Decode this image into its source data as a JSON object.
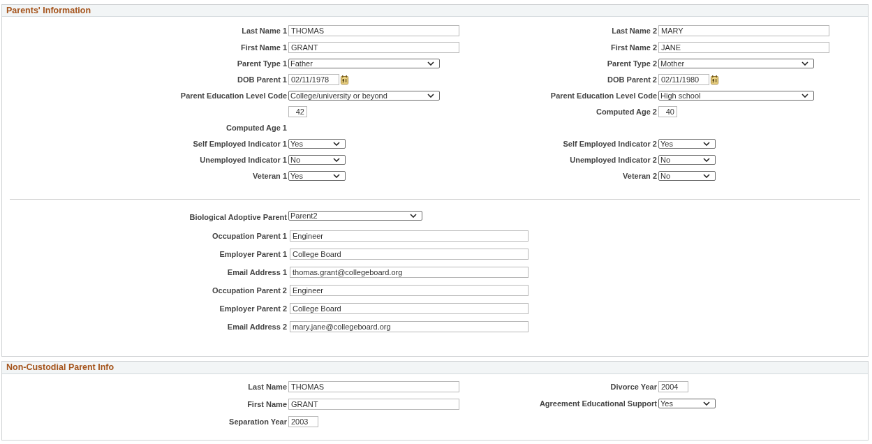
{
  "parents_information": {
    "title": "Parents' Information",
    "columns": [
      {
        "fields": [
          {
            "label": "Last Name 1",
            "kind": "text",
            "value": "THOMAS"
          },
          {
            "label": "First Name 1",
            "kind": "text",
            "value": "GRANT"
          },
          {
            "label": "Parent Type 1",
            "kind": "select",
            "value": "Father"
          },
          {
            "label": "DOB Parent 1",
            "kind": "date",
            "value": "02/11/1978"
          },
          {
            "label": "Parent Education Level Code",
            "kind": "select",
            "value": "College/university or beyond"
          },
          {
            "label": "Computed Age 1",
            "kind": "number",
            "value": "42"
          }
        ],
        "indicators": [
          {
            "label": "Self Employed Indicator 1",
            "kind": "yesno",
            "value": "Yes"
          },
          {
            "label": "Unemployed Indicator 1",
            "kind": "yesno",
            "value": "No"
          },
          {
            "label": "Veteran 1",
            "kind": "yesno",
            "value": "Yes"
          }
        ]
      },
      {
        "fields": [
          {
            "label": "Last Name 2",
            "kind": "text",
            "value": "MARY"
          },
          {
            "label": "First Name 2",
            "kind": "text",
            "value": "JANE"
          },
          {
            "label": "Parent Type 2",
            "kind": "select",
            "value": "Mother"
          },
          {
            "label": "DOB Parent 2",
            "kind": "date",
            "value": "02/11/1980"
          },
          {
            "label": "Parent Education Level Code",
            "kind": "select",
            "value": "High school"
          },
          {
            "label": "Computed Age 2",
            "kind": "number",
            "value": "40"
          }
        ],
        "indicators": [
          {
            "label": "Self Employed Indicator 2",
            "kind": "yesno",
            "value": "Yes"
          },
          {
            "label": "Unemployed Indicator 2",
            "kind": "yesno",
            "value": "No"
          },
          {
            "label": "Veteran 2",
            "kind": "yesno",
            "value": "No"
          }
        ]
      }
    ],
    "details": [
      {
        "label": "Biological Adoptive Parent",
        "kind": "select",
        "value": "Parent2"
      },
      {
        "label": "Occupation Parent 1",
        "kind": "text",
        "value": "Engineer"
      },
      {
        "label": "Employer Parent 1",
        "kind": "text",
        "value": "College Board"
      },
      {
        "label": "Email Address 1",
        "kind": "text",
        "value": "thomas.grant@collegeboard.org"
      },
      {
        "label": "Occupation Parent 2",
        "kind": "text",
        "value": "Engineer"
      },
      {
        "label": "Employer Parent 2",
        "kind": "text",
        "value": "College Board"
      },
      {
        "label": "Email Address 2",
        "kind": "text",
        "value": "mary.jane@collegeboard.org"
      }
    ]
  },
  "non_custodial_parent_info": {
    "title": "Non-Custodial Parent Info",
    "columns": [
      {
        "fields": [
          {
            "label": "Last Name",
            "kind": "text",
            "value": "THOMAS"
          },
          {
            "label": "First Name",
            "kind": "text",
            "value": "GRANT"
          },
          {
            "label": "Separation Year",
            "kind": "year",
            "value": "2003"
          }
        ]
      },
      {
        "fields": [
          {
            "label": "Divorce Year",
            "kind": "year",
            "value": "2004"
          },
          {
            "label": "Agreement Educational Support",
            "kind": "yesno",
            "value": "Yes"
          }
        ]
      }
    ]
  }
}
